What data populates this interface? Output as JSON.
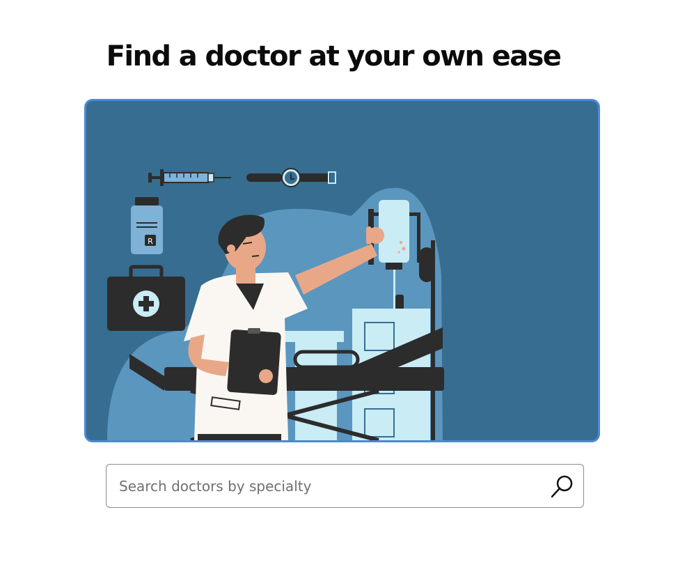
{
  "page": {
    "title": "Find a doctor at your own ease"
  },
  "hero": {
    "icon": "doctor-illustration",
    "prescription_label": "R"
  },
  "search": {
    "placeholder": "Search doctors by specialty",
    "value": "",
    "button_icon": "search-icon"
  },
  "colors": {
    "accent_border": "#4a8ad8",
    "hero_background": "#376d90",
    "hero_blob": "#5b96bf",
    "light_cyan": "#c9ecf5",
    "dark": "#2c2c2c",
    "skin": "#e8a888"
  }
}
